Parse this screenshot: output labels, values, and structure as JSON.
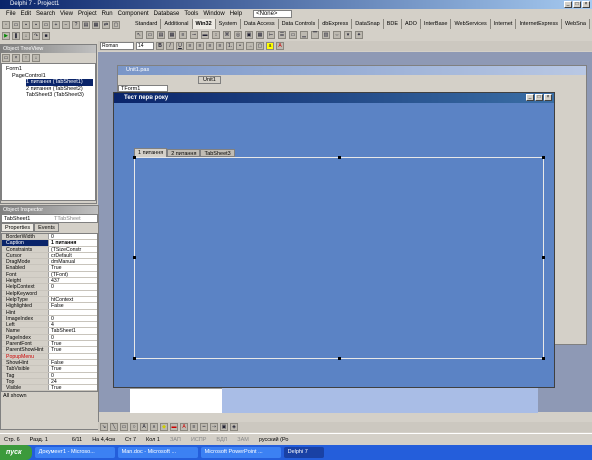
{
  "app": {
    "title": "Delphi 7 - Project1"
  },
  "menu": [
    "File",
    "Edit",
    "Search",
    "View",
    "Project",
    "Run",
    "Component",
    "Database",
    "Tools",
    "Window",
    "Help"
  ],
  "desktop_combo": "<None>",
  "palette_tabs": [
    "Standard",
    "Additional",
    "Win32",
    "System",
    "Data Access",
    "Data Controls",
    "dbExpress",
    "DataSnap",
    "BDE",
    "ADO",
    "InterBase",
    "WebServices",
    "Internet",
    "InternetExpress",
    "WebSna"
  ],
  "palette_active": "Win32",
  "font_combo": "Roman",
  "font_size": "14",
  "tree_view": {
    "title": "Object TreeView",
    "items": [
      "Form1",
      "PageControl1",
      "1 питання (TabSheet1)",
      "2 питання (TabSheet2)",
      "TabSheet3 (TabSheet3)"
    ]
  },
  "unit_window": {
    "title": "Unit1.pas",
    "tab": "Unit1",
    "combo": "TForm1"
  },
  "form": {
    "title": "Тест перв року",
    "tabs": [
      "1 питання",
      "2 питання",
      "TabSheet3"
    ]
  },
  "inspector": {
    "title": "Object Inspector",
    "selector": "TabSheet1",
    "selector_type": "TTabSheet",
    "tabs": [
      "Properties",
      "Events"
    ],
    "rows": [
      [
        "BorderWidth",
        "0"
      ],
      [
        "Caption",
        "1 питання"
      ],
      [
        "Constraints",
        "(TSizeConstr"
      ],
      [
        "Cursor",
        "crDefault"
      ],
      [
        "DragMode",
        "dmManual"
      ],
      [
        "Enabled",
        "True"
      ],
      [
        "Font",
        "(TFont)"
      ],
      [
        "Height",
        "437"
      ],
      [
        "HelpContext",
        "0"
      ],
      [
        "HelpKeyword",
        ""
      ],
      [
        "HelpType",
        "htContext"
      ],
      [
        "Highlighted",
        "False"
      ],
      [
        "Hint",
        ""
      ],
      [
        "ImageIndex",
        "0"
      ],
      [
        "Left",
        "4"
      ],
      [
        "Name",
        "TabSheet1"
      ],
      [
        "PageIndex",
        "0"
      ],
      [
        "ParentFont",
        "True"
      ],
      [
        "ParentShowHint",
        "True"
      ],
      [
        "PopupMenu",
        ""
      ],
      [
        "ShowHint",
        "False"
      ],
      [
        "TabVisible",
        "True"
      ],
      [
        "Tag",
        "0"
      ],
      [
        "Top",
        "24"
      ],
      [
        "Visible",
        "True"
      ]
    ],
    "footer": "All shown"
  },
  "status": {
    "items": [
      "Стр. 6",
      "Разд. 1",
      "6/11",
      "На 4,4см",
      "Ст 7",
      "Кол 1",
      "ЗАП",
      "ИСПР",
      "ВДЛ",
      "ЗАМ",
      "русский (Ро"
    ]
  },
  "taskbar": {
    "start": "пуск",
    "items": [
      "Документ1 - Microso...",
      "Man.doc - Microsoft ...",
      "Microsoft PowerPoint ...",
      "Delphi 7"
    ]
  },
  "colors": {
    "form_bg": "#5b83c5",
    "desktop_bg": "#8e99b5",
    "titlebar": "#0a246a",
    "taskbar": "#245edb"
  }
}
